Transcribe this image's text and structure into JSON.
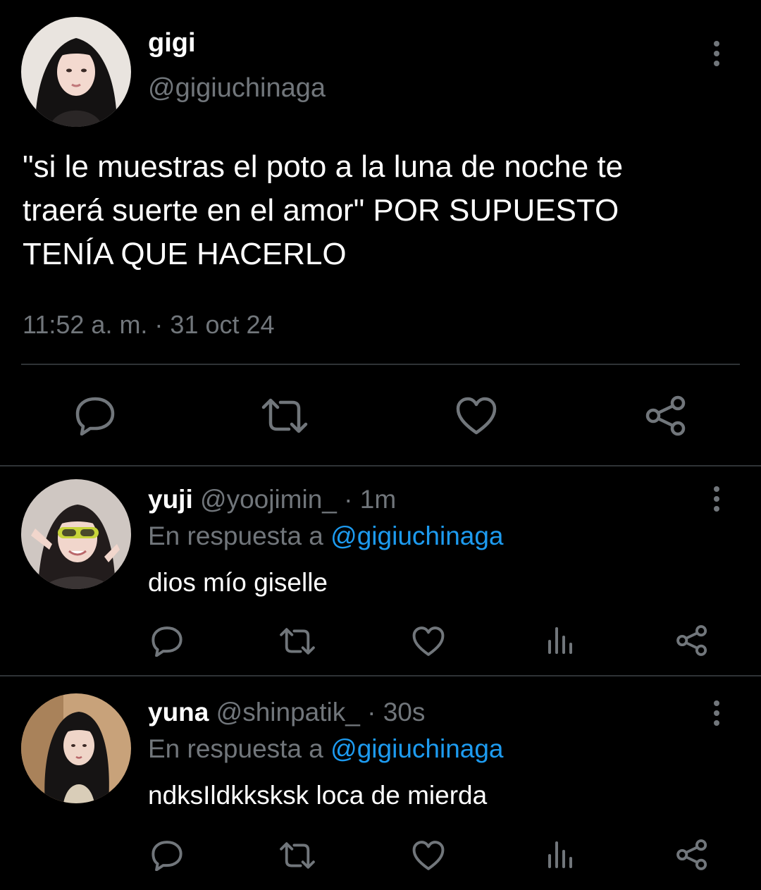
{
  "main_tweet": {
    "display_name": "gigi",
    "handle": "@gigiuchinaga",
    "text_lines": [
      "\"si le muestras el poto a la luna de noche te",
      "traerá suerte en el amor\" POR SUPUESTO",
      "TENÍA QUE HACERLO"
    ],
    "timestamp": "11:52 a. m. · 31 oct 24",
    "actions": [
      "reply-icon",
      "retweet-icon",
      "like-icon",
      "share-icon"
    ]
  },
  "replies": [
    {
      "display_name": "yuji",
      "handle": "@yoojimin_",
      "time": "· 1m",
      "reply_prefix": "En respuesta a",
      "reply_to": "@gigiuchinaga",
      "text": "dios mío giselle",
      "actions": [
        "reply-icon",
        "retweet-icon",
        "like-icon",
        "views-icon",
        "share-icon"
      ]
    },
    {
      "display_name": "yuna",
      "handle": "@shinpatik_",
      "time": "· 30s",
      "reply_prefix": "En respuesta a",
      "reply_to": "@gigiuchinaga",
      "text": "ndksIldkksksk loca de mierda",
      "actions": [
        "reply-icon",
        "retweet-icon",
        "like-icon",
        "views-icon",
        "share-icon"
      ]
    }
  ],
  "colors": {
    "background": "#000000",
    "text": "#ffffff",
    "muted": "#71767b",
    "link": "#1d9bf0",
    "divider": "#2f3336"
  }
}
